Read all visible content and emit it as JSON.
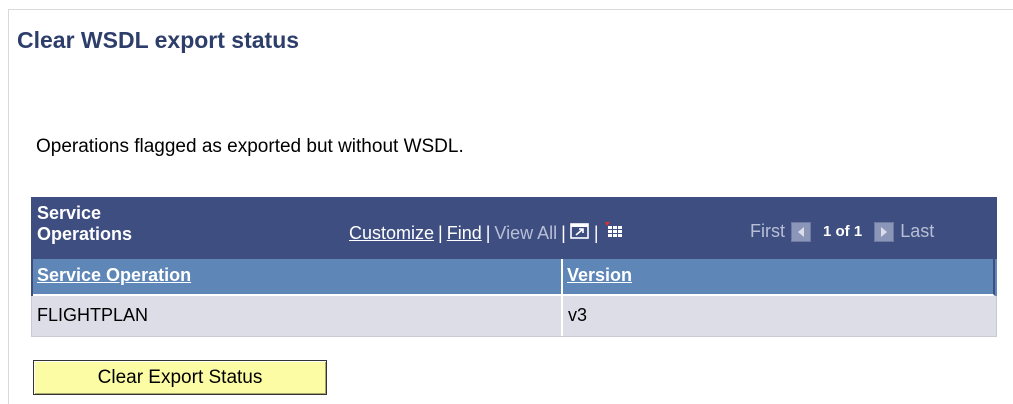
{
  "page": {
    "title": "Clear WSDL export status",
    "instructions": "Operations flagged as exported but without WSDL."
  },
  "grid": {
    "title": "Service Operations",
    "nav": {
      "customize": "Customize",
      "find": "Find",
      "view_all": "View All",
      "separator": "|"
    },
    "icons": [
      "new-window-icon",
      "download-grid-icon"
    ],
    "pager": {
      "first": "First",
      "count": "1 of 1",
      "last": "Last"
    },
    "columns": [
      "Service Operation",
      "Version"
    ],
    "rows": [
      {
        "service_operation": "FLIGHTPLAN",
        "version": "v3"
      }
    ]
  },
  "actions": {
    "clear_button": "Clear Export Status"
  },
  "colors": {
    "title": "#2e3e6b",
    "grid_header": "#3f4e81",
    "column_header": "#5e86b6",
    "row_bg": "#dcdde6",
    "button_bg": "#fcfca4"
  }
}
